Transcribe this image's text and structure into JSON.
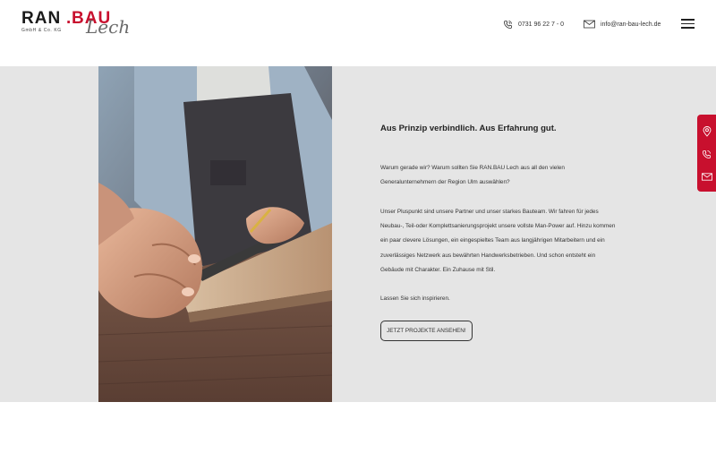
{
  "header": {
    "logo": {
      "ran": "RAN",
      "dot": ".",
      "bau": "BAU",
      "script": "Lech",
      "subtitle": "GmbH & Co. KG"
    },
    "phone": {
      "icon": "phone-icon",
      "text": "0731 96 22 7 - 0"
    },
    "email": {
      "icon": "mail-icon",
      "text": "info@ran-bau-lech.de"
    },
    "menu_icon": "hamburger-menu-icon"
  },
  "main": {
    "headline": "Aus Prinzip verbindlich. Aus Erfahrung gut.",
    "paragraph1": "Warum gerade wir? Warum sollten Sie RAN.BAU Lech aus all den vielen Generalunternehmern der Region Ulm auswählen?",
    "paragraph2": "Unser Pluspunkt sind unsere Partner und unser starkes Bauteam. Wir fahren für jedes Neubau-, Teil-oder Komplettsanierungsprojekt unsere vollste Man-Power auf. Hinzu kommen ein paar clevere Lösungen, ein eingespieltes Team aus langjährigen Mitarbeitern und ein zuverlässiges Netzwerk aus bewährten Handwerksbetrieben. Und schon entsteht ein Gebäude mit Charakter. Ein Zuhause mit Stil.",
    "paragraph3": "Lassen Sie sich inspirieren.",
    "cta_label": "JETZT PROJEKTE ANSEHEN!"
  },
  "sidetabs": [
    "location-pin-icon",
    "phone-icon",
    "mail-icon"
  ],
  "colors": {
    "brand_red": "#c8102e",
    "section_bg": "#e5e5e5",
    "text": "#222222"
  }
}
